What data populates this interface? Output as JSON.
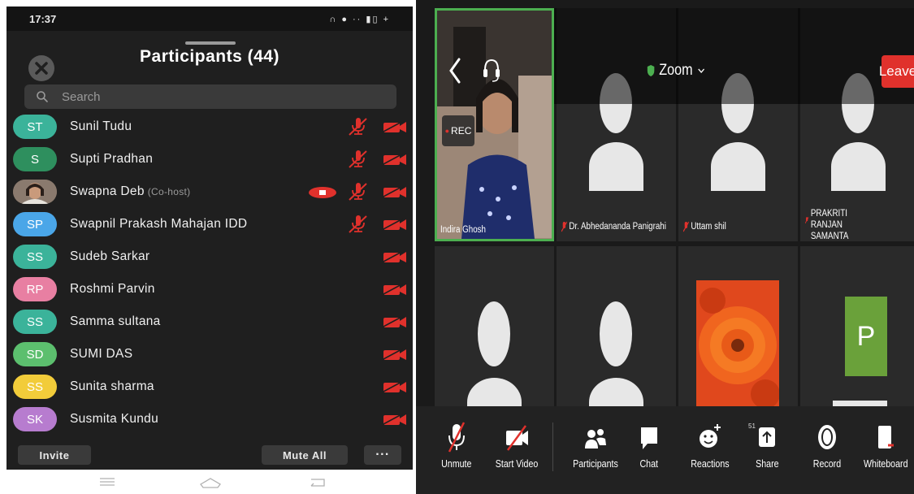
{
  "phone": {
    "status": {
      "time": "17:37",
      "right_icons": "∩ ● ·· ▮▯ +"
    },
    "title": "Participants (44)",
    "search": {
      "placeholder": "Search"
    },
    "participants": [
      {
        "initials": "ST",
        "name": "Sunil Tudu",
        "color": "#3bb39a",
        "mic_muted": true,
        "video_off": true
      },
      {
        "initials": "S",
        "name": "Supti Pradhan",
        "color": "#2e8f5e",
        "mic_muted": true,
        "video_off": true
      },
      {
        "initials": "",
        "name": "Swapna Deb",
        "role": "(Co-host)",
        "photo": true,
        "sharing": true,
        "mic_muted": true,
        "video_off": true
      },
      {
        "initials": "SP",
        "name": "Swapnil Prakash Mahajan IDD",
        "color": "#4aa6e8",
        "mic_muted": true,
        "video_off": true
      },
      {
        "initials": "SS",
        "name": "Sudeb Sarkar",
        "color": "#3bb39a",
        "video_off": true
      },
      {
        "initials": "RP",
        "name": "Roshmi Parvin",
        "color": "#e87fa2",
        "video_off": true
      },
      {
        "initials": "SS",
        "name": "Samma sultana",
        "color": "#3bb39a",
        "video_off": true
      },
      {
        "initials": "SD",
        "name": "SUMI DAS",
        "color": "#5cbf6e",
        "video_off": true
      },
      {
        "initials": "SS",
        "name": "Sunita sharma",
        "color": "#f2cc3a",
        "video_off": true
      },
      {
        "initials": "SK",
        "name": "Susmita Kundu",
        "color": "#b77ccf",
        "video_off": true
      }
    ],
    "buttons": {
      "invite": "Invite",
      "mute_all": "Mute All",
      "more": "···"
    }
  },
  "zoom": {
    "title": "Zoom",
    "leave": "Leave",
    "rec": "REC",
    "tiles": [
      {
        "name": "Indira Ghosh",
        "active_speaker": true
      },
      {
        "name": "Dr. Abhedananda Panigrahi",
        "muted": true
      },
      {
        "name": "Uttam shil",
        "muted": true
      },
      {
        "name": "PRAKRITI RANJAN SAMANTA",
        "muted": true
      },
      {
        "name": ""
      },
      {
        "name": ""
      },
      {
        "name": "",
        "image": "flower"
      },
      {
        "name": "",
        "letter": "P"
      }
    ],
    "toolbar": {
      "unmute": "Unmute",
      "start_video": "Start Video",
      "participants": "Participants",
      "participants_count": "51",
      "chat": "Chat",
      "reactions": "Reactions",
      "share": "Share",
      "record": "Record",
      "whiteboard": "Whiteboard"
    },
    "colors": {
      "accent_green": "#4caf50",
      "leave_red": "#e0312c",
      "mute_red": "#e0312c"
    }
  }
}
